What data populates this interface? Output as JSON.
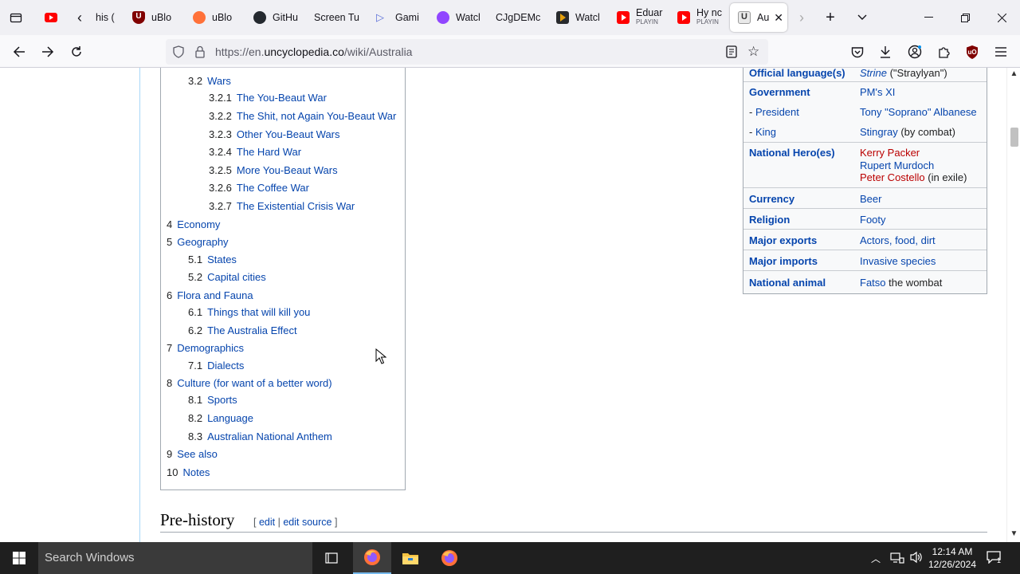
{
  "tabs": [
    {
      "title": "his (",
      "icon": "back-arrow-icon"
    },
    {
      "title": "uBlo",
      "icon": "ublock-icon"
    },
    {
      "title": "uBlo",
      "icon": "firefox-icon"
    },
    {
      "title": "GitHu",
      "icon": "github-icon"
    },
    {
      "title": "Screen Tu",
      "icon": ""
    },
    {
      "title": "Gami",
      "icon": "play-icon"
    },
    {
      "title": "Watcl",
      "icon": "twitch-icon"
    },
    {
      "title": "CJgDEMc",
      "icon": ""
    },
    {
      "title": "Watcl",
      "icon": "plex-icon"
    },
    {
      "title": "Eduar",
      "sub": "PLAYIN",
      "icon": "youtube-icon"
    },
    {
      "title": "Hy nc",
      "sub": "PLAYIN",
      "icon": "youtube-icon"
    },
    {
      "title": "Au",
      "icon": "uncyclopedia-icon",
      "active": true
    }
  ],
  "nav": {
    "url_prefix": "https://en.",
    "url_domain": "uncyclopedia.co",
    "url_path": "/wiki/Australia"
  },
  "toc": [
    {
      "num": "3.2",
      "text": "Wars"
    },
    {
      "num": "3.2.1",
      "text": "The You-Beaut War"
    },
    {
      "num": "3.2.2",
      "text": "The Shit, not Again You-Beaut War"
    },
    {
      "num": "3.2.3",
      "text": "Other You-Beaut Wars"
    },
    {
      "num": "3.2.4",
      "text": "The Hard War"
    },
    {
      "num": "3.2.5",
      "text": "More You-Beaut Wars"
    },
    {
      "num": "3.2.6",
      "text": "The Coffee War"
    },
    {
      "num": "3.2.7",
      "text": "The Existential Crisis War"
    },
    {
      "num": "4",
      "text": "Economy"
    },
    {
      "num": "5",
      "text": "Geography"
    },
    {
      "num": "5.1",
      "text": "States"
    },
    {
      "num": "5.2",
      "text": "Capital cities"
    },
    {
      "num": "6",
      "text": "Flora and Fauna"
    },
    {
      "num": "6.1",
      "text": "Things that will kill you"
    },
    {
      "num": "6.2",
      "text": "The Australia Effect"
    },
    {
      "num": "7",
      "text": "Demographics"
    },
    {
      "num": "7.1",
      "text": "Dialects"
    },
    {
      "num": "8",
      "text": "Culture (for want of a better word)"
    },
    {
      "num": "8.1",
      "text": "Sports"
    },
    {
      "num": "8.2",
      "text": "Language"
    },
    {
      "num": "8.3",
      "text": "Australian National Anthem"
    },
    {
      "num": "9",
      "text": "See also"
    },
    {
      "num": "10",
      "text": "Notes"
    }
  ],
  "infobox": {
    "official_language": {
      "label": "Official language(s)",
      "value_link": "Strine",
      "value_rest": " (\"Straylyan\")"
    },
    "government": {
      "label": "Government",
      "value": "PM's XI"
    },
    "president": {
      "prefix": "- ",
      "label": "President",
      "value": "Tony \"Soprano\" Albanese"
    },
    "king": {
      "prefix": "- ",
      "label": "King",
      "value_link": "Stingray",
      "value_rest": " (by combat)"
    },
    "heroes": {
      "label": "National Hero(es)",
      "v1": "Kerry Packer",
      "v2": "Rupert Murdoch",
      "v3": "Peter Costello",
      "v3_rest": " (in exile)"
    },
    "currency": {
      "label": "Currency",
      "value": "Beer"
    },
    "religion": {
      "label": "Religion",
      "value": "Footy"
    },
    "exports": {
      "label": "Major exports",
      "value": "Actors, food, dirt"
    },
    "imports": {
      "label": "Major imports",
      "value": "Invasive species"
    },
    "animal": {
      "label": "National animal",
      "value_link": "Fatso",
      "value_rest": " the wombat"
    }
  },
  "section": {
    "heading": "Pre-history",
    "edit_open": "[ ",
    "edit": "edit",
    "sep": " | ",
    "edit_source": "edit source",
    "edit_close": " ]"
  },
  "taskbar": {
    "search_placeholder": "Search Windows",
    "time": "12:14 AM",
    "date": "12/26/2024",
    "notif_count": "1"
  },
  "colors": {
    "link": "#0645ad",
    "redlink": "#ba0000",
    "taskbar": "#1f1f1f"
  }
}
